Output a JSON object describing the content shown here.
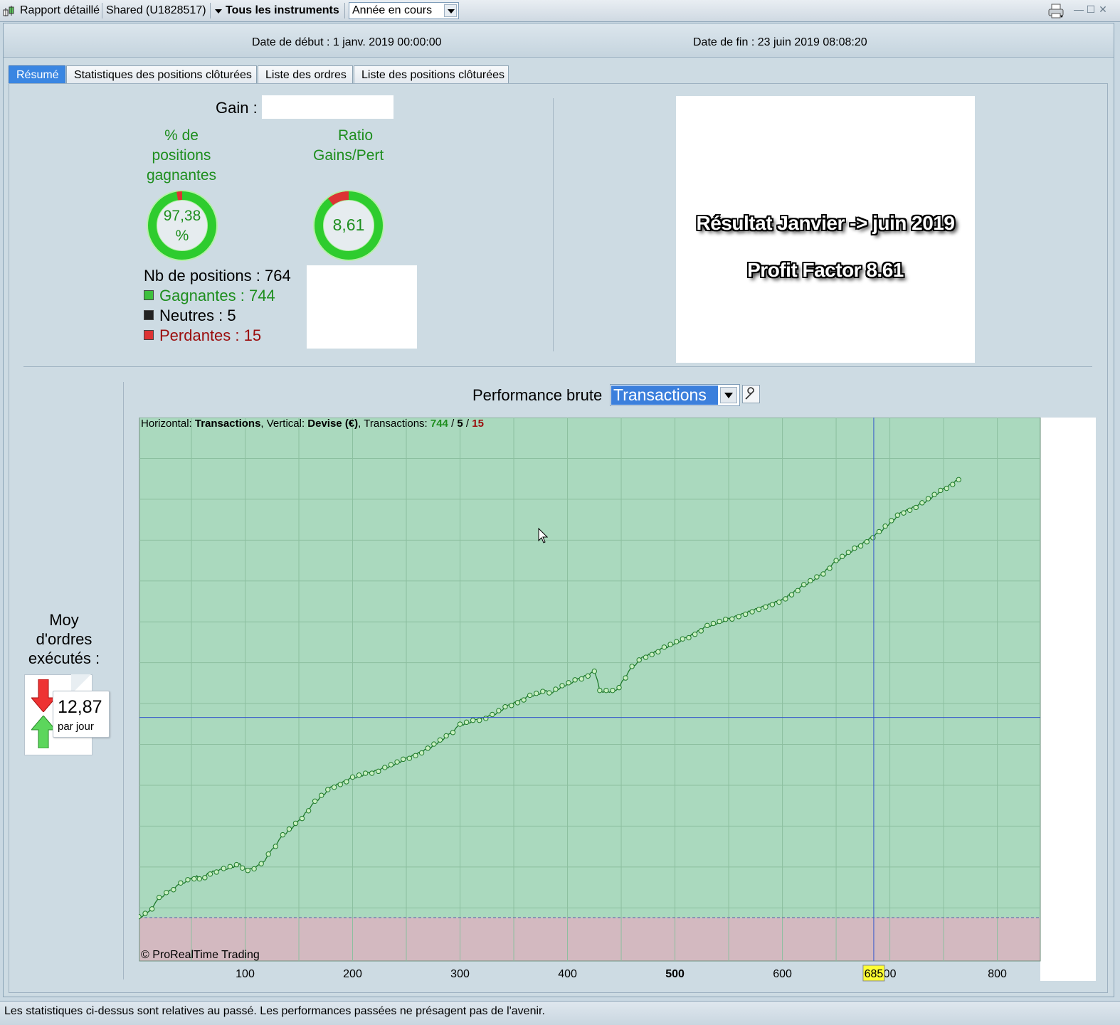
{
  "titlebar": {
    "report": "Rapport détaillé",
    "account": "Shared (U1828517)",
    "instruments": "Tous les instruments",
    "period": "Année en cours"
  },
  "dates": {
    "start": "Date de début : 1 janv. 2019 00:00:00",
    "end": "Date de fin : 23 juin 2019 08:08:20"
  },
  "tabs": [
    {
      "label": "Résumé",
      "active": true
    },
    {
      "label": "Statistiques des positions clôturées",
      "active": false
    },
    {
      "label": "Liste des ordres",
      "active": false
    },
    {
      "label": "Liste des positions clôturées",
      "active": false
    }
  ],
  "summary": {
    "gain_label": "Gain :",
    "win_pct_title_1": "% de",
    "win_pct_title_2": "positions",
    "win_pct_title_3": "gagnantes",
    "win_pct_value_1": "97,38",
    "win_pct_value_2": "%",
    "win_pct_fraction": 0.9738,
    "ratio_title_1": "Ratio",
    "ratio_title_2": "Gains/Pert",
    "ratio_value": "8,61",
    "ratio_fraction": 0.896,
    "positions_total": "Nb de positions : 764",
    "winning": "Gagnantes : 744",
    "neutral": "Neutres : 5",
    "losing": "Perdantes : 15"
  },
  "overlay": {
    "line1": "Résultat Janvier -> juin 2019",
    "line2": "Profit Factor 8.61"
  },
  "orders": {
    "title_1": "Moy",
    "title_2": "d'ordres",
    "title_3": "exécutés :",
    "value": "12,87",
    "unit": "par jour"
  },
  "performance": {
    "label": "Performance brute",
    "selected": "Transactions",
    "info_horizontal_label": "Horizontal: ",
    "info_horizontal_value": "Transactions",
    "info_vertical_label": ", Vertical: ",
    "info_vertical_value": "Devise (€)",
    "info_tx_label": ", Transactions: ",
    "info_tx_win": "744",
    "info_tx_sep1": " / ",
    "info_tx_neutral": "5",
    "info_tx_sep2": " / ",
    "info_tx_lose": "15",
    "copyright": "© ProRealTime Trading",
    "cursor_x_label": "685"
  },
  "chart_data": {
    "type": "line",
    "xlim": [
      1,
      840
    ],
    "x_ticks": [
      100,
      200,
      300,
      400,
      500,
      600,
      700,
      800
    ],
    "x_tick_labels": [
      "100",
      "200",
      "300",
      "400",
      "500",
      "600",
      "00",
      "800"
    ],
    "x_tick_bold": [
      500
    ],
    "cursor_x": 685,
    "cursor_y": 0.416,
    "profit_area_color": "#aad9be",
    "loss_area_color": "#d3b9c0",
    "line_color": "#1e7a2a",
    "grid": true,
    "series": [
      {
        "x": [
          1,
          10,
          20,
          30,
          40,
          50,
          55,
          60,
          65,
          70,
          80,
          95,
          100,
          105,
          115,
          125,
          135,
          150,
          165,
          180,
          200,
          215,
          230,
          250,
          270,
          290,
          300,
          315,
          330,
          345,
          365,
          380,
          383,
          395,
          410,
          425,
          428,
          430,
          445,
          460,
          470,
          490,
          510,
          530,
          550,
          575,
          600,
          620,
          635,
          650,
          670,
          690,
          710,
          730,
          750,
          764
        ],
        "y": [
          0.0,
          0.01,
          0.04,
          0.055,
          0.07,
          0.08,
          0.085,
          0.08,
          0.09,
          0.095,
          0.1,
          0.11,
          0.1,
          0.1,
          0.11,
          0.14,
          0.17,
          0.2,
          0.24,
          0.27,
          0.29,
          0.3,
          0.31,
          0.33,
          0.35,
          0.38,
          0.4,
          0.41,
          0.42,
          0.44,
          0.46,
          0.47,
          0.465,
          0.48,
          0.495,
          0.51,
          0.49,
          0.47,
          0.47,
          0.52,
          0.54,
          0.56,
          0.58,
          0.605,
          0.62,
          0.64,
          0.66,
          0.69,
          0.71,
          0.74,
          0.77,
          0.8,
          0.84,
          0.86,
          0.89,
          0.91
        ]
      }
    ]
  },
  "footer": "Les statistiques ci-dessus sont relatives au passé. Les performances passées ne présagent pas de l'avenir.",
  "colors": {
    "win": "#1e8e1e",
    "lose": "#9b0d0d",
    "accent": "#3a86e2"
  }
}
